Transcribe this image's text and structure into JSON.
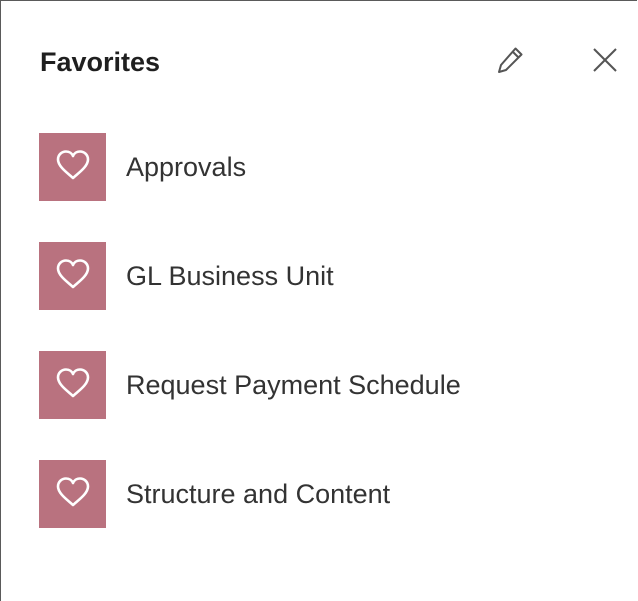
{
  "panel": {
    "title": "Favorites",
    "edit_icon": "pencil-icon",
    "close_icon": "close-icon"
  },
  "favorites": {
    "tile_color": "#b9727f",
    "tile_icon": "heart-icon",
    "items": [
      {
        "label": "Approvals"
      },
      {
        "label": "GL Business Unit"
      },
      {
        "label": "Request Payment Schedule"
      },
      {
        "label": "Structure and Content"
      }
    ]
  }
}
